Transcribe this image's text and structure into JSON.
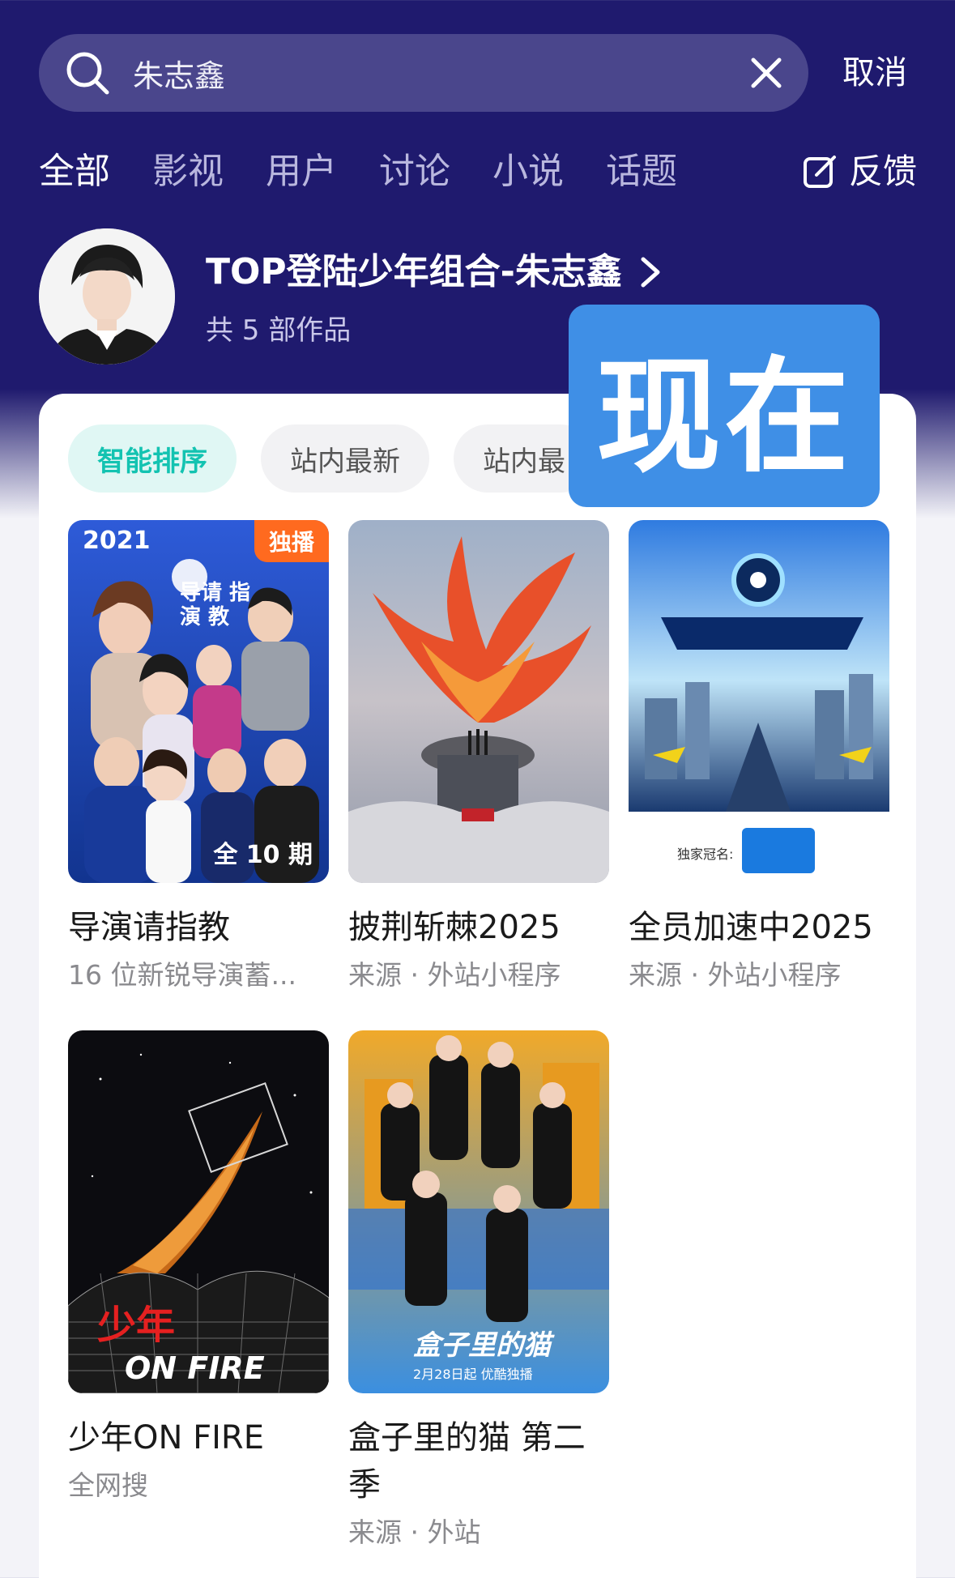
{
  "search": {
    "query": "朱志鑫",
    "cancel_label": "取消"
  },
  "tabs": [
    {
      "label": "全部",
      "active": true
    },
    {
      "label": "影视",
      "active": false
    },
    {
      "label": "用户",
      "active": false
    },
    {
      "label": "讨论",
      "active": false
    },
    {
      "label": "小说",
      "active": false
    },
    {
      "label": "话题",
      "active": false
    }
  ],
  "feedback_label": "反馈",
  "profile": {
    "title": "TOP登陆少年组合-朱志鑫",
    "subtitle": "共 5 部作品"
  },
  "now_badge": "现在",
  "sort_chips": [
    {
      "label": "智能排序",
      "active": true
    },
    {
      "label": "站内最新",
      "active": false
    },
    {
      "label": "站内最",
      "active": false
    }
  ],
  "items": [
    {
      "title": "导演请指教",
      "subtitle": "16 位新锐导演蓄...",
      "year": "2021",
      "exclusive": "独播",
      "episodes": "全 10 期"
    },
    {
      "title": "披荆斩棘2025",
      "subtitle": "来源 · 外站小程序"
    },
    {
      "title": "全员加速中2025",
      "subtitle": "来源 · 外站小程序"
    },
    {
      "title": "少年ON FIRE",
      "subtitle": "全网搜"
    },
    {
      "title": "盒子里的猫 第二季",
      "subtitle": "来源 · 外站"
    }
  ],
  "colors": {
    "header_bg": "#1f1a6e",
    "accent": "#13c3b1",
    "exclusive": "#ff6a1f",
    "now_badge": "#3f8fe6"
  }
}
